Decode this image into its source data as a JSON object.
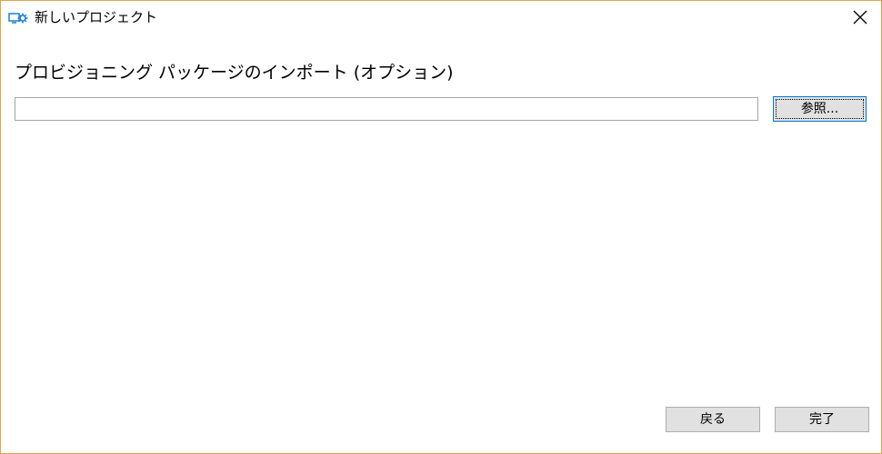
{
  "window": {
    "title": "新しいプロジェクト",
    "icon": "project-designer-icon",
    "border_color": "#e3a24a"
  },
  "main": {
    "heading": "プロビジョニング パッケージのインポート (オプション)",
    "path_input": {
      "value": "",
      "placeholder": ""
    },
    "browse_label": "参照..."
  },
  "footer": {
    "back_label": "戻る",
    "finish_label": "完了"
  },
  "colors": {
    "accent": "#0078d7",
    "icon_blue": "#1c7fd6",
    "button_face": "#e1e1e1"
  }
}
